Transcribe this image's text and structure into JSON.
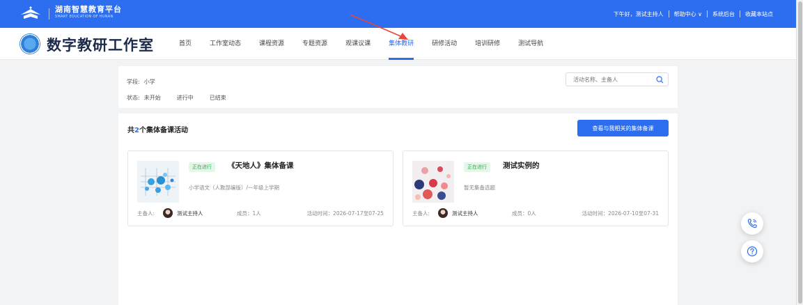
{
  "topbar": {
    "brand_cn": "湖南智慧教育平台",
    "brand_en": "SMART EDUCATION OF HUNAN",
    "greeting": "下午好，测试主持人",
    "help": "帮助中心 ∨",
    "admin": "系统后台",
    "bookmark": "收藏本站点"
  },
  "header": {
    "site_title": "数字教研工作室",
    "nav": [
      {
        "label": "首页"
      },
      {
        "label": "工作室动态"
      },
      {
        "label": "课程资源"
      },
      {
        "label": "专题资源"
      },
      {
        "label": "观课议课"
      },
      {
        "label": "集体教研"
      },
      {
        "label": "研修活动"
      },
      {
        "label": "培训研修"
      },
      {
        "label": "测试导航"
      }
    ],
    "active_index": 5
  },
  "filter": {
    "stage_label": "学段:",
    "stage_value": "小学",
    "status_label": "状态:",
    "status_options": [
      "未开始",
      "进行中",
      "已结束"
    ],
    "search_placeholder": "活动名称、主备人"
  },
  "results": {
    "count_prefix": "共",
    "count": "2",
    "count_suffix": "个集体备课活动",
    "related_button": "查看与我相关的集体备课",
    "cards": [
      {
        "badge": "正在进行",
        "title": "《天地人》集体备课",
        "subject": "小学语文（人教部编版）/一年级上学期",
        "host_label": "主备人:",
        "host_name": "测试主持人",
        "members": "成员：1人",
        "time": "活动时间：2026-07-17至07-25"
      },
      {
        "badge": "正在进行",
        "title": "测试实例的",
        "subject": "暂无集备选题",
        "host_label": "主备人:",
        "host_name": "测试主持人",
        "members": "成员：0人",
        "time": "活动时间：2026-07-10至07-31"
      }
    ]
  },
  "colors": {
    "primary": "#2d6ef0",
    "badge_bg": "#e6f7e9",
    "badge_text": "#2fa84f",
    "arrow": "#e8453c"
  },
  "icons": {
    "float_1": "phone-icon",
    "float_2": "help-icon",
    "search": "search-icon"
  }
}
